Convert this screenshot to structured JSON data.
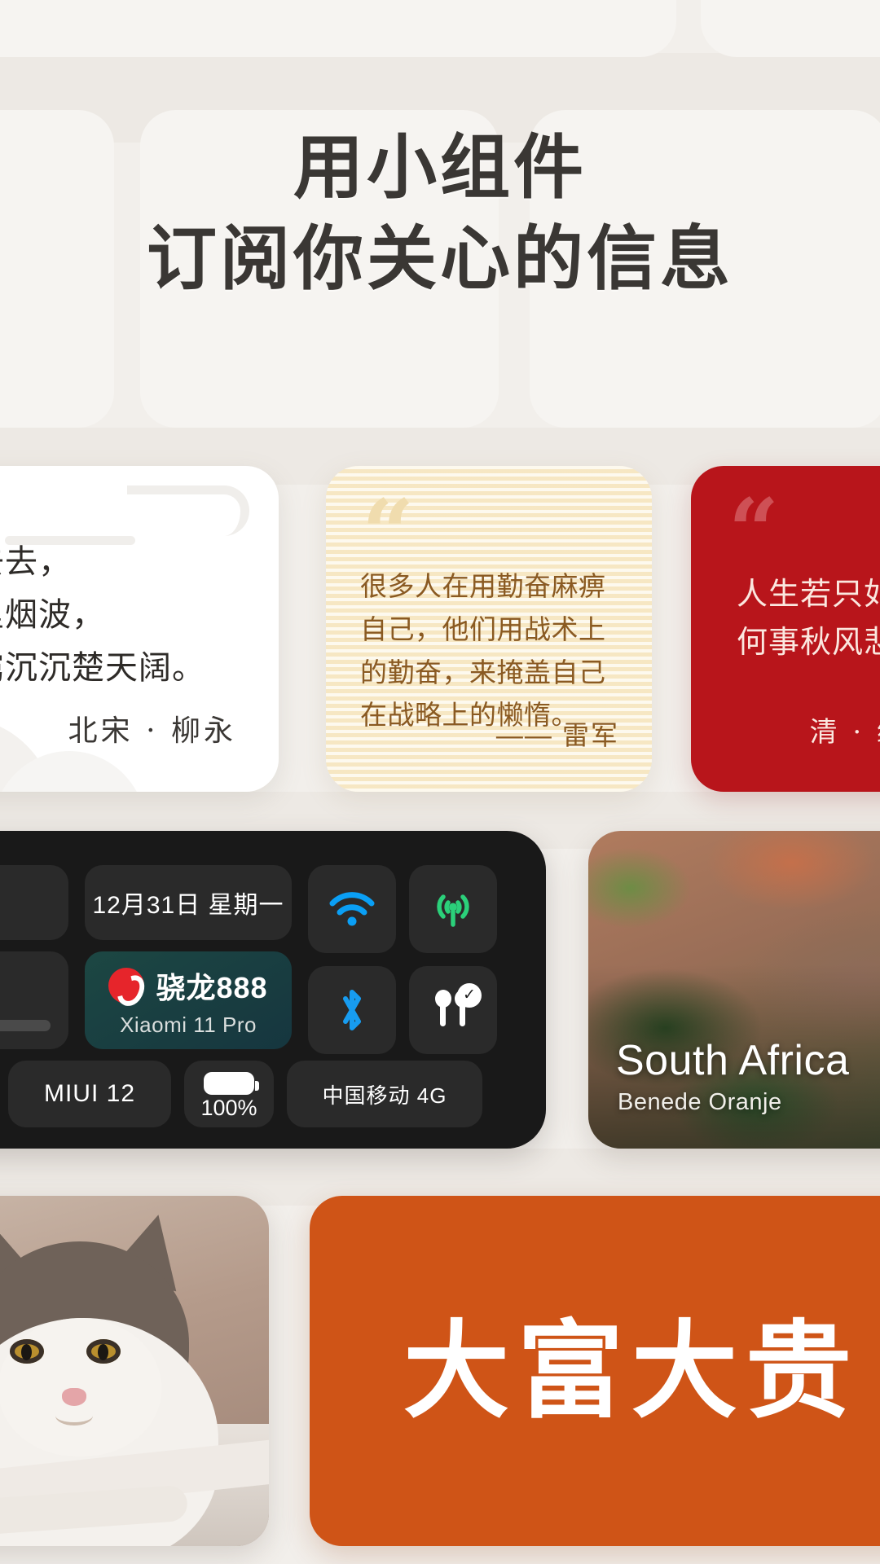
{
  "page": {
    "background_color": "#F2EFEB",
    "band_color": "#EDE9E4",
    "ghost_card_color": "#F6F4F1"
  },
  "headline": {
    "line1": "用小组件",
    "line2": "订阅你关心的信息",
    "color": "#3A3734"
  },
  "widgets": {
    "poem_card": {
      "name": "poetry-widget",
      "background": "#FFFFFF",
      "lines": [
        "念去去，",
        "千里烟波，",
        "暮霭沉沉楚天阔。"
      ],
      "author": "北宋 · 柳永",
      "cloud_icon": "cloud-swirl-icon",
      "mountain_icon": "mountain-icon"
    },
    "quote_card": {
      "name": "quote-widget-yellow",
      "background": "#FBEFD2",
      "text_color": "#8A5A22",
      "quote_mark": "“",
      "body": "很多人在用勤奋麻痹自己，他们用战术上的勤奋，来掩盖自己在战略上的懒惰。",
      "author": "—— 雷军"
    },
    "red_card": {
      "name": "quote-widget-red",
      "background": "#B8151B",
      "text_color": "#FBE7DF",
      "quote_mark": "“",
      "line1": "人生若只如初见",
      "line2": "何事秋风悲画扇",
      "author": "清 · 纳兰性德"
    },
    "status_card": {
      "name": "device-status-widget",
      "background": "#191919",
      "date": "12月31日  星期一",
      "chip_name": "骁龙888",
      "chip_subtitle": "Xiaomi 11 Pro",
      "chip_logo": "snapdragon-logo-icon",
      "system_version": "MIUI 12",
      "battery_percent": "100%",
      "battery_icon": "battery-full-icon",
      "carrier": "中国移动  4G",
      "wifi_icon": "wifi-icon",
      "wifi_color": "#0A9FF5",
      "signal_icon": "cellular-signal-icon",
      "signal_color": "#2BD07A",
      "bluetooth_icon": "bluetooth-icon",
      "bluetooth_color": "#179CF0",
      "airpods_icon": "airpods-icon",
      "airpods_badge": "✓"
    },
    "map_card": {
      "name": "satellite-map-widget",
      "title": "South Africa",
      "subtitle": "Benede Oranje"
    },
    "cat_card": {
      "name": "photo-widget-cat",
      "subject": "cat-photo"
    },
    "fortune_card": {
      "name": "fortune-widget",
      "background": "#CF5417",
      "text": "大富大贵",
      "text_color": "#FFFFFF"
    }
  }
}
